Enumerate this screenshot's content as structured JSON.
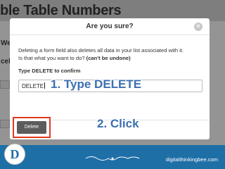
{
  "background": {
    "title": "ble Table Numbers",
    "side_text_1": "We",
    "side_text_2": "cel"
  },
  "modal": {
    "title": "Are you sure?",
    "close_icon": "close-icon",
    "message_line_1": "Deleting a form field also deletes all data in your list associated with it.",
    "message_line_2_prefix": "Is that what you want to do? ",
    "message_line_2_bold": "(can't be undone)",
    "confirm_label": "Type DELETE to confirm",
    "confirm_value": "DELETE",
    "delete_label": "Delete"
  },
  "annotations": {
    "step1": "1. Type DELETE",
    "step2": "2. Click"
  },
  "footer": {
    "site": "digitalthinkingbee.com",
    "logo_letter": "D"
  },
  "colors": {
    "accent_red": "#e03a1f",
    "annotation_blue": "#3b6fb0",
    "footer_blue": "#1f6fa7"
  }
}
